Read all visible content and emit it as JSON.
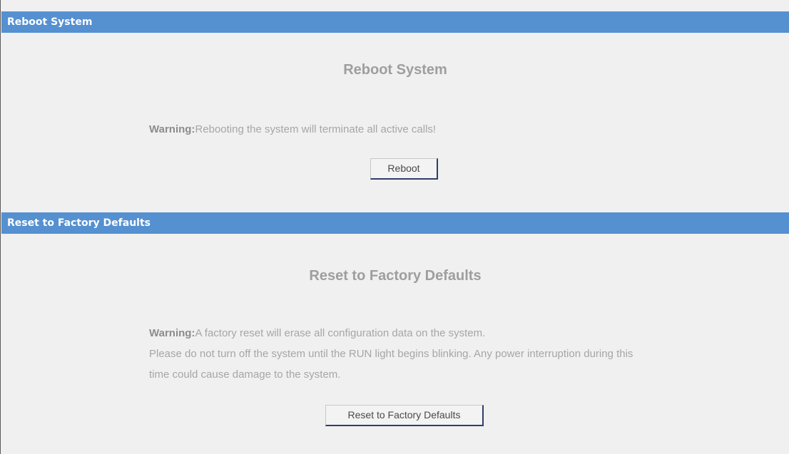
{
  "reboot": {
    "header": "Reboot System",
    "title": "Reboot System",
    "warning_label": "Warning:",
    "warning_text": "Rebooting the system will terminate all active calls!",
    "button_label": "Reboot"
  },
  "factory_reset": {
    "header": "Reset to Factory Defaults",
    "title": "Reset to Factory Defaults",
    "warning_label": "Warning:",
    "warning_text": "A factory reset will erase all configuration data on the system.",
    "note_line1": "Please do not turn off the system until the RUN light begins blinking. Any power interruption during this",
    "note_line2": "time could cause damage to the system.",
    "button_label": "Reset to Factory Defaults"
  },
  "colors": {
    "header_bg": "#5590d1",
    "page_bg": "#f0f0f0",
    "text_gray": "#a6a6a6"
  }
}
